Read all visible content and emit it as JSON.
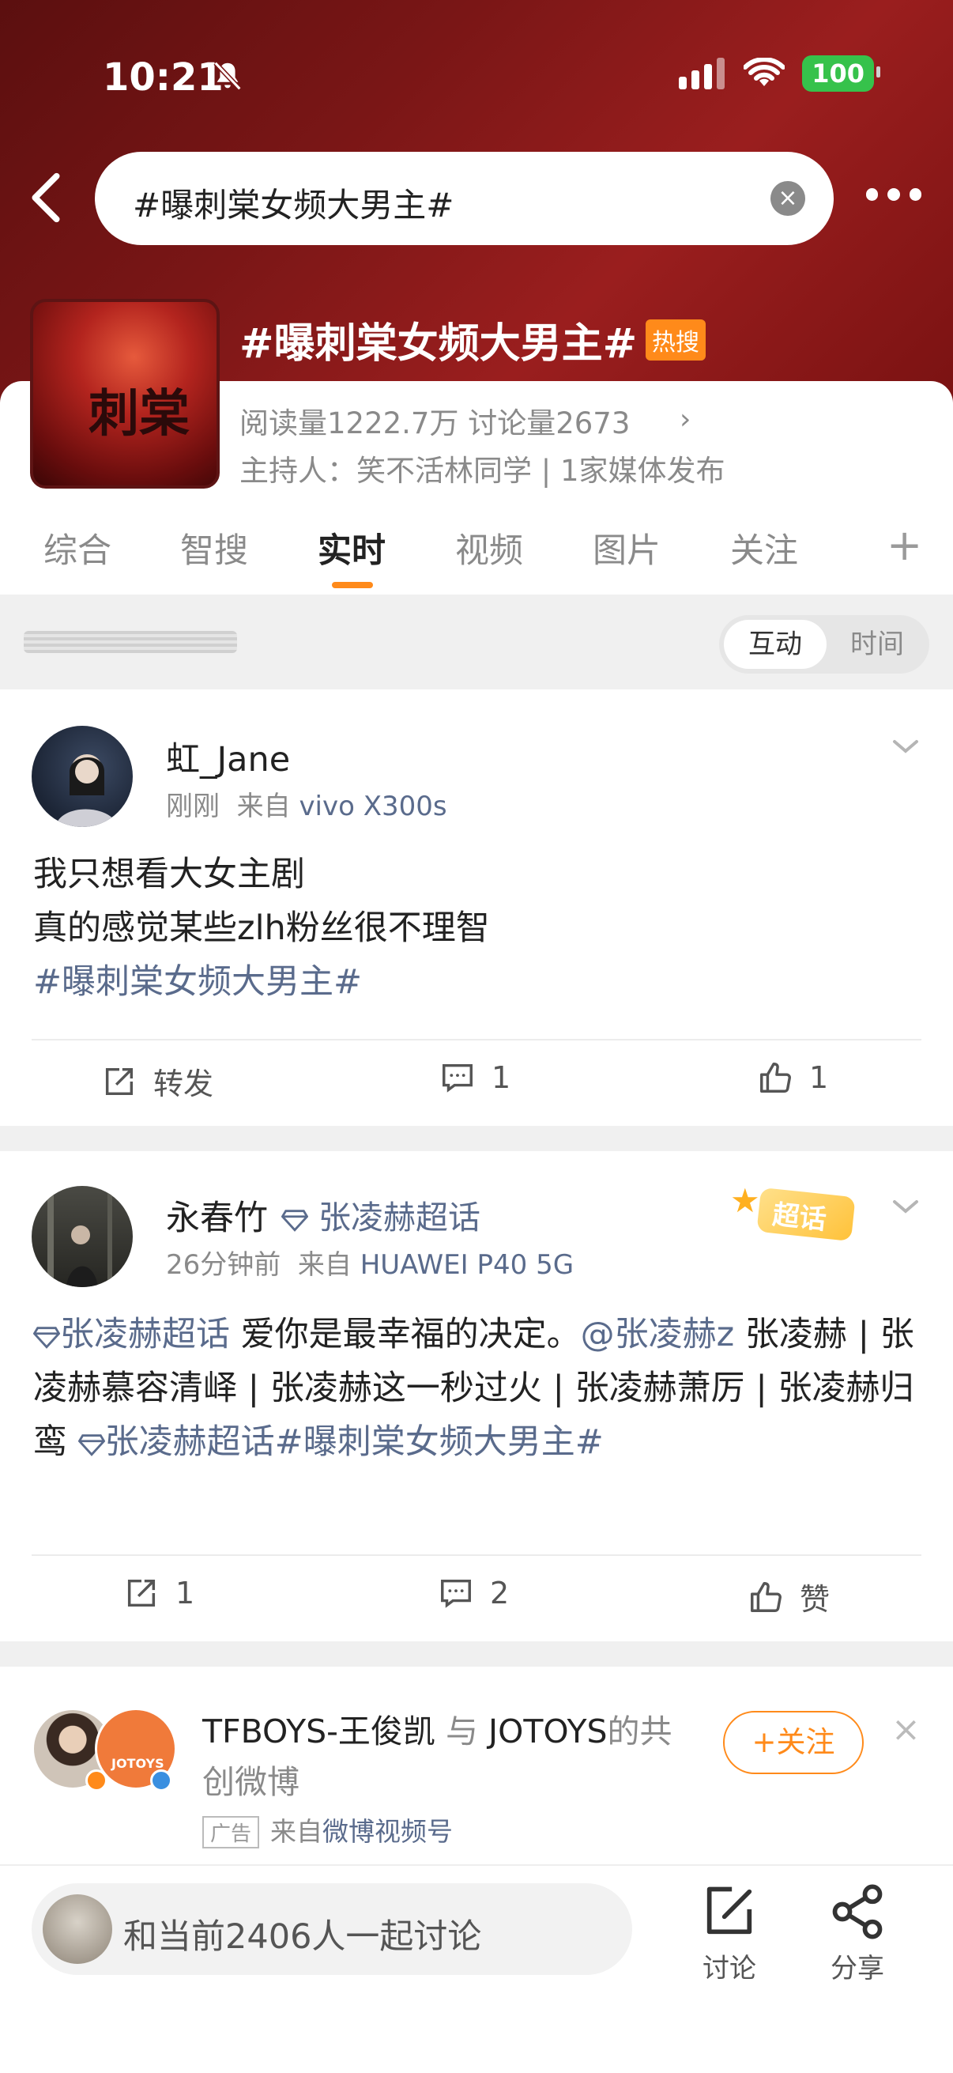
{
  "status_bar": {
    "time": "10:21",
    "battery": "100"
  },
  "search": {
    "query": "#曝刺棠女频大男主#"
  },
  "topic": {
    "title": "#曝刺棠女频大男主#",
    "hot_badge": "热搜",
    "cover_text": "刺棠",
    "stats": "阅读量1222.7万  讨论量2673",
    "host": "主持人：笑不活林同学 | 1家媒体发布"
  },
  "tabs": [
    "综合",
    "智搜",
    "实时",
    "视频",
    "图片",
    "关注"
  ],
  "active_tab": "实时",
  "sort_toggle": {
    "on": "互动",
    "off": "时间"
  },
  "posts": [
    {
      "user": "虹_Jane",
      "time": "刚刚",
      "source_prefix": "来自",
      "source": "vivo X300s",
      "lines": [
        "我只想看大女主剧",
        "真的感觉某些zlh粉丝很不理智"
      ],
      "hashtag": "#曝刺棠女频大男主#",
      "actions": {
        "repost": "转发",
        "comment": "1",
        "like": "1"
      }
    },
    {
      "user": "永春竹",
      "super_topic": "张凌赫超话",
      "super_badge": "超话",
      "time": "26分钟前",
      "source_prefix": "来自",
      "source": "HUAWEI P40 5G",
      "content_link1": "张凌赫超话",
      "content_text1": " 爱你是最幸福的决定。",
      "content_mention": "@张凌赫z",
      "content_text2": "张凌赫 | 张凌赫慕容清峄 | 张凌赫这一秒过火 | 张凌赫萧厉 | 张凌赫归鸾 ",
      "content_link2": "张凌赫超话",
      "content_hashtag": "#曝刺棠女频大男主#",
      "actions": {
        "repost": "1",
        "comment": "2",
        "like": "赞"
      }
    }
  ],
  "ad": {
    "title_a": "TFBOYS-王俊凯",
    "title_join": " 与 ",
    "title_b": "JOTOYS",
    "title_c": "的共创微博",
    "badge": "广告",
    "source_prefix": "来自",
    "source": "微博视频号",
    "follow": "+关注",
    "logo_text": "JOTOYS"
  },
  "bottom_bar": {
    "discuss_placeholder": "和当前2406人一起讨论",
    "discuss_label": "讨论",
    "share_label": "分享"
  },
  "colors": {
    "accent": "#ff8a1a",
    "link": "#5a6b8c",
    "header": "#8a1a1a"
  }
}
